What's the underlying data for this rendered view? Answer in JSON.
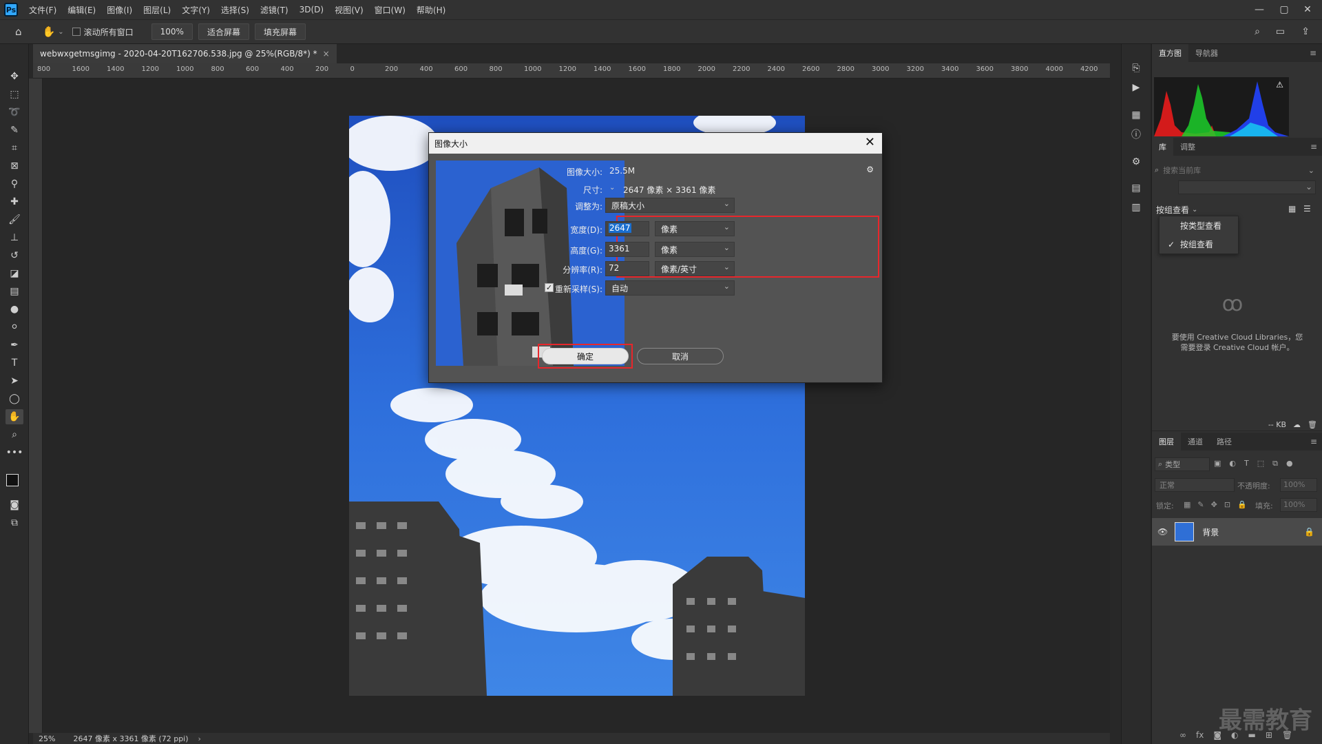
{
  "app": {
    "logo": "Ps",
    "menu": [
      "文件(F)",
      "编辑(E)",
      "图像(I)",
      "图层(L)",
      "文字(Y)",
      "选择(S)",
      "滤镜(T)",
      "3D(D)",
      "视图(V)",
      "窗口(W)",
      "帮助(H)"
    ]
  },
  "options": {
    "scroll_all_label": "滚动所有窗口",
    "zoom_btn": "100%",
    "fit_screen": "适合屏幕",
    "fill_screen": "填充屏幕"
  },
  "document_tab": {
    "title": "webwxgetmsgimg - 2020-04-20T162706.538.jpg @ 25%(RGB/8*) *",
    "close": "×"
  },
  "ruler": {
    "h_ticks": [
      "800",
      "1600",
      "1400",
      "1200",
      "1000",
      "800",
      "600",
      "400",
      "200",
      "0",
      "200",
      "400",
      "600",
      "800",
      "1000",
      "1200",
      "1400",
      "1600",
      "1800",
      "2000",
      "2200",
      "2400",
      "2600",
      "2800",
      "3000",
      "3200",
      "3400",
      "3600",
      "3800",
      "4000",
      "4200"
    ]
  },
  "status": {
    "zoom": "25%",
    "doc_info": "2647 像素 x 3361 像素 (72 ppi)",
    "arrow": "›"
  },
  "dialog": {
    "title": "图像大小",
    "close": "✕",
    "image_size_label": "图像大小:",
    "image_size_value": "25.5M",
    "dimensions_label": "尺寸:",
    "dimensions_value": "2647 像素  ×  3361 像素",
    "fit_to_label": "调整为:",
    "fit_to_value": "原稿大小",
    "width_label": "宽度(D):",
    "width_value": "2647",
    "width_unit": "像素",
    "height_label": "高度(G):",
    "height_value": "3361",
    "height_unit": "像素",
    "resolution_label": "分辨率(R):",
    "resolution_value": "72",
    "resolution_unit": "像素/英寸",
    "resample_label": "重新采样(S):",
    "resample_value": "自动",
    "ok": "确定",
    "cancel": "取消"
  },
  "panels": {
    "histogram_tab": "直方图",
    "navigator_tab": "导航器",
    "library_tab": "库",
    "adjust_tab": "调整",
    "library_search_placeholder": "搜索当前库",
    "view_by": "按组查看",
    "view_menu": [
      "按类型查看",
      "按组查看"
    ],
    "cc_message_1": "要使用 Creative Cloud Libraries，您",
    "cc_message_2": "需要登录 Creative Cloud 帐户。",
    "kb": "-- KB",
    "layers_tab": "图层",
    "channels_tab": "通道",
    "paths_tab": "路径",
    "kind_label": "类型",
    "blend_mode": "正常",
    "opacity_label": "不透明度:",
    "opacity_value": "100%",
    "lock_label": "锁定:",
    "fill_label": "填充:",
    "fill_value": "100%",
    "layer_name": "背景"
  },
  "watermark": "最需教育",
  "colors": {
    "accent": "#31a8ff",
    "highlight_box": "#e8262b",
    "sky": "#2f6fd6"
  }
}
